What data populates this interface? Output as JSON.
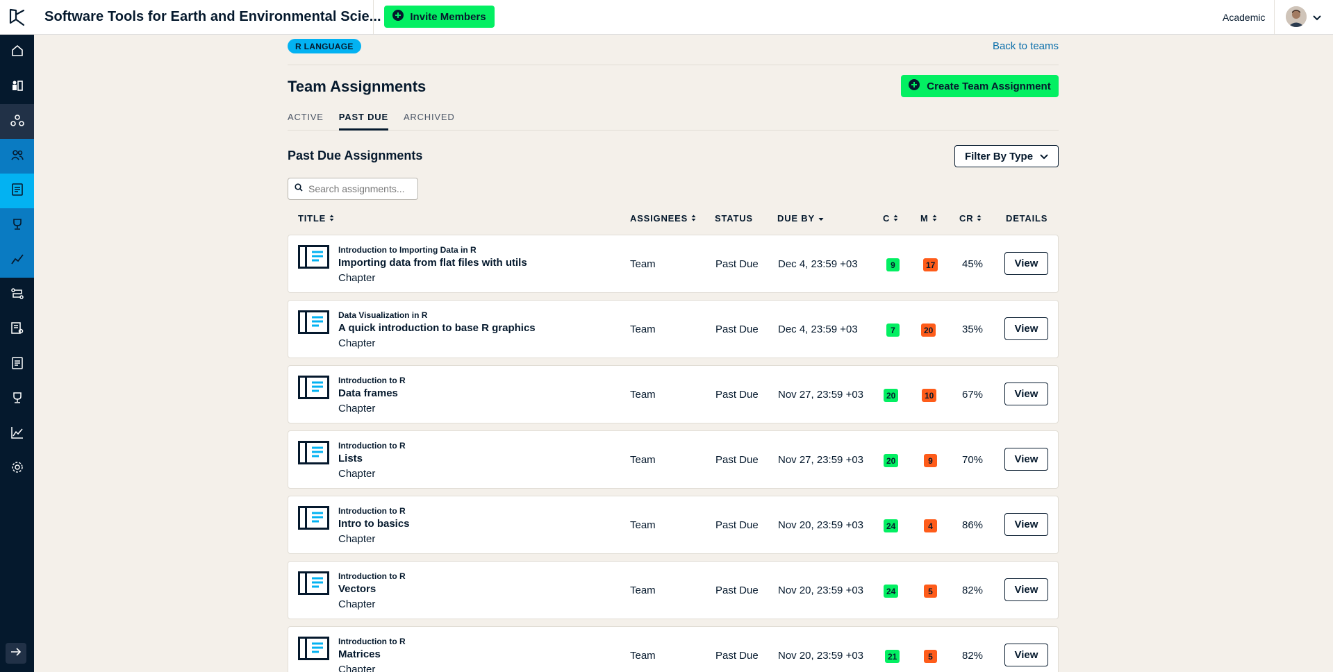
{
  "topbar": {
    "workspace_title": "Software Tools for Earth and Environmental Scie...",
    "invite_label": "Invite Members",
    "account_label": "Academic"
  },
  "sidebar": {
    "items": [
      {
        "icon": "home-icon"
      },
      {
        "icon": "groups-icon"
      },
      {
        "icon": "hub-icon"
      },
      {
        "icon": "members-icon"
      },
      {
        "icon": "assignments-icon"
      },
      {
        "icon": "trophy-icon"
      },
      {
        "icon": "chart-icon"
      },
      {
        "icon": "tracks-icon"
      },
      {
        "icon": "reports-icon"
      },
      {
        "icon": "document-icon"
      },
      {
        "icon": "trophy-outline-icon"
      },
      {
        "icon": "chart-outline-icon"
      },
      {
        "icon": "settings-icon"
      }
    ]
  },
  "team": {
    "tag": "R LANGUAGE",
    "back_link": "Back to teams",
    "title": "Team Assignments",
    "create_label": "Create Team Assignment"
  },
  "tabs": [
    "ACTIVE",
    "PAST DUE",
    "ARCHIVED"
  ],
  "active_tab": "PAST DUE",
  "section": {
    "title": "Past Due Assignments",
    "filter_label": "Filter By Type",
    "search_placeholder": "Search assignments..."
  },
  "columns": {
    "title": "TITLE",
    "assignees": "ASSIGNEES",
    "status": "STATUS",
    "due_by": "DUE BY",
    "c": "C",
    "m": "M",
    "cr": "CR",
    "details": "DETAILS"
  },
  "assignments": [
    {
      "course": "Introduction to Importing Data in R",
      "chapter": "Importing data from flat files with utils",
      "type": "Chapter",
      "assignees": "Team",
      "status": "Past Due",
      "due": "Dec 4, 23:59 +03",
      "c": "9",
      "m": "17",
      "cr": "45%",
      "action": "View"
    },
    {
      "course": "Data Visualization in R",
      "chapter": "A quick introduction to base R graphics",
      "type": "Chapter",
      "assignees": "Team",
      "status": "Past Due",
      "due": "Dec 4, 23:59 +03",
      "c": "7",
      "m": "20",
      "cr": "35%",
      "action": "View"
    },
    {
      "course": "Introduction to R",
      "chapter": "Data frames",
      "type": "Chapter",
      "assignees": "Team",
      "status": "Past Due",
      "due": "Nov 27, 23:59 +03",
      "c": "20",
      "m": "10",
      "cr": "67%",
      "action": "View"
    },
    {
      "course": "Introduction to R",
      "chapter": "Lists",
      "type": "Chapter",
      "assignees": "Team",
      "status": "Past Due",
      "due": "Nov 27, 23:59 +03",
      "c": "20",
      "m": "9",
      "cr": "70%",
      "action": "View"
    },
    {
      "course": "Introduction to R",
      "chapter": "Intro to basics",
      "type": "Chapter",
      "assignees": "Team",
      "status": "Past Due",
      "due": "Nov 20, 23:59 +03",
      "c": "24",
      "m": "4",
      "cr": "86%",
      "action": "View"
    },
    {
      "course": "Introduction to R",
      "chapter": "Vectors",
      "type": "Chapter",
      "assignees": "Team",
      "status": "Past Due",
      "due": "Nov 20, 23:59 +03",
      "c": "24",
      "m": "5",
      "cr": "82%",
      "action": "View"
    },
    {
      "course": "Introduction to R",
      "chapter": "Matrices",
      "type": "Chapter",
      "assignees": "Team",
      "status": "Past Due",
      "due": "Nov 20, 23:59 +03",
      "c": "21",
      "m": "5",
      "cr": "82%",
      "action": "View"
    }
  ]
}
